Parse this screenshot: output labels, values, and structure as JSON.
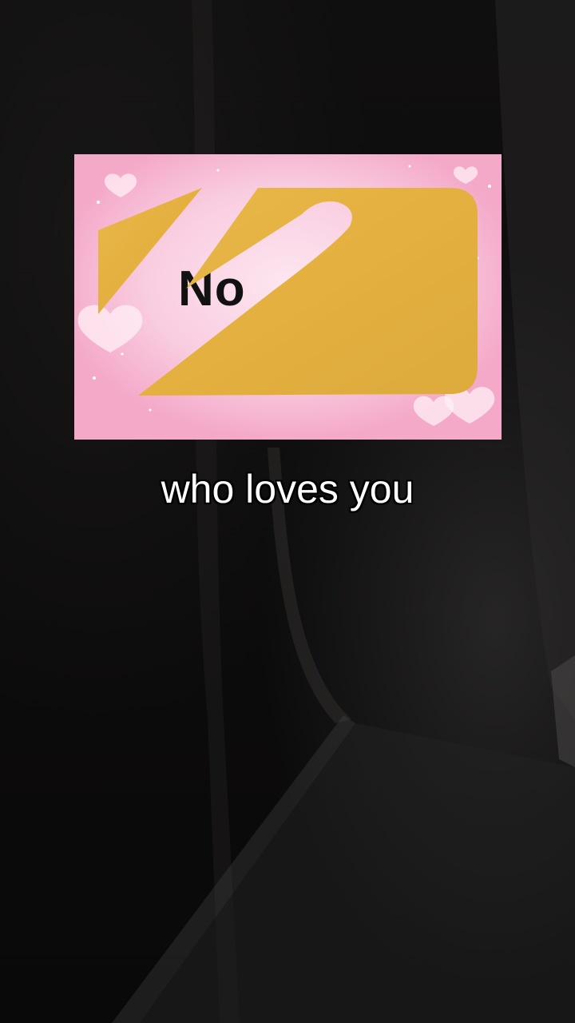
{
  "card": {
    "revealed_text": "No",
    "scratch_color": "#e6b443",
    "background_color": "#f7b6d2"
  },
  "caption": {
    "text": "who loves you"
  }
}
